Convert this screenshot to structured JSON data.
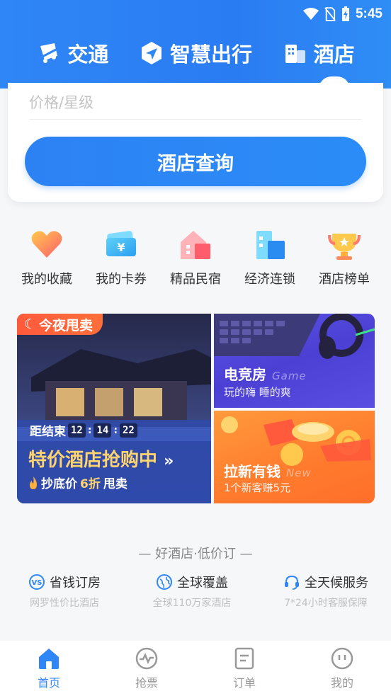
{
  "status_bar": {
    "time": "5:45"
  },
  "top_tabs": [
    {
      "label": "交通",
      "icon": "transport-icon"
    },
    {
      "label": "智慧出行",
      "icon": "smart-travel-icon"
    },
    {
      "label": "酒店",
      "icon": "hotel-icon",
      "active": true
    }
  ],
  "search": {
    "price_placeholder": "价格/星级",
    "button_label": "酒店查询"
  },
  "quick_menu": [
    {
      "label": "我的收藏",
      "icon": "heart-icon"
    },
    {
      "label": "我的卡券",
      "icon": "coupon-icon"
    },
    {
      "label": "精品民宿",
      "icon": "homestay-icon"
    },
    {
      "label": "经济连锁",
      "icon": "chain-hotel-icon"
    },
    {
      "label": "酒店榜单",
      "icon": "trophy-icon"
    }
  ],
  "banner_main": {
    "badge": "今夜甩卖",
    "countdown_label": "距结束",
    "countdown": [
      "12",
      "14",
      "22"
    ],
    "title": "特价酒店抢购中",
    "title_arrow": "»",
    "sub_prefix": "抄底价",
    "sub_highlight": "6折",
    "sub_suffix": "甩卖"
  },
  "banner_esports": {
    "title": "电竞房",
    "en": "Game",
    "sub": "玩的嗨 睡的爽"
  },
  "banner_referral": {
    "title": "拉新有钱",
    "en": "New",
    "sub": "1个新客赚5元"
  },
  "slogan": "— 好酒店·低价订 —",
  "features": [
    {
      "title": "省钱订房",
      "sub": "网罗性价比酒店",
      "icon": "vs-icon"
    },
    {
      "title": "全球覆盖",
      "sub": "全球110万家酒店",
      "icon": "globe-icon"
    },
    {
      "title": "全天候服务",
      "sub": "7*24小时客服保障",
      "icon": "headset-icon"
    }
  ],
  "bottom_nav": [
    {
      "label": "首页",
      "icon": "home-icon",
      "active": true
    },
    {
      "label": "抢票",
      "icon": "ticket-grab-icon"
    },
    {
      "label": "订单",
      "icon": "order-icon"
    },
    {
      "label": "我的",
      "icon": "profile-icon"
    }
  ],
  "colors": {
    "primary": "#2f86f6",
    "accent_orange": "#ff6f3a",
    "gold": "#ffd36e"
  }
}
